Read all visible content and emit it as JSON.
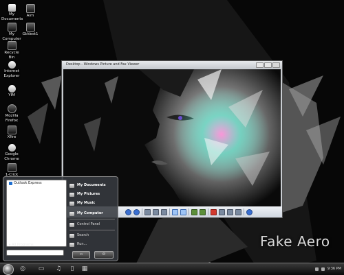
{
  "desktop": {
    "icons": [
      {
        "label": "My Documents",
        "icon": "folder-icon"
      },
      {
        "label": "My Computer",
        "icon": "computer-icon"
      },
      {
        "label": "Recycle Bin",
        "icon": "recycle-bin-icon"
      },
      {
        "label": "Internet Explorer",
        "icon": "internet-explorer-icon"
      },
      {
        "label": "YIM",
        "icon": "yahoo-messenger-icon"
      },
      {
        "label": "Mozilla Firefox",
        "icon": "firefox-icon"
      },
      {
        "label": "Xfire",
        "icon": "xfire-icon"
      },
      {
        "label": "Google Chrome",
        "icon": "chrome-icon"
      },
      {
        "label": "1-Click",
        "icon": "app-icon"
      },
      {
        "label": "Aim",
        "icon": "aim-icon"
      },
      {
        "label": "GbVest1",
        "icon": "app-icon"
      }
    ]
  },
  "viewer": {
    "title": "Desktop - Windows Picture and Fax Viewer"
  },
  "start_menu": {
    "pinned": [
      "Outlook Express"
    ],
    "all_programs": "All Programs",
    "right_items": [
      "My Documents",
      "My Pictures",
      "My Music",
      "My Computer"
    ],
    "right_items_secondary": [
      "Control Panel",
      "Search",
      "Run..."
    ]
  },
  "taskbar": {
    "clock": "9:36 PM"
  },
  "watermark": "Fake Aero",
  "colors": {
    "taskbar_top": "#3a3a3a",
    "taskbar_bottom": "#0a0a0a",
    "menu_bg": "#373a40",
    "toolbar_accent": "#3a6fd1"
  }
}
